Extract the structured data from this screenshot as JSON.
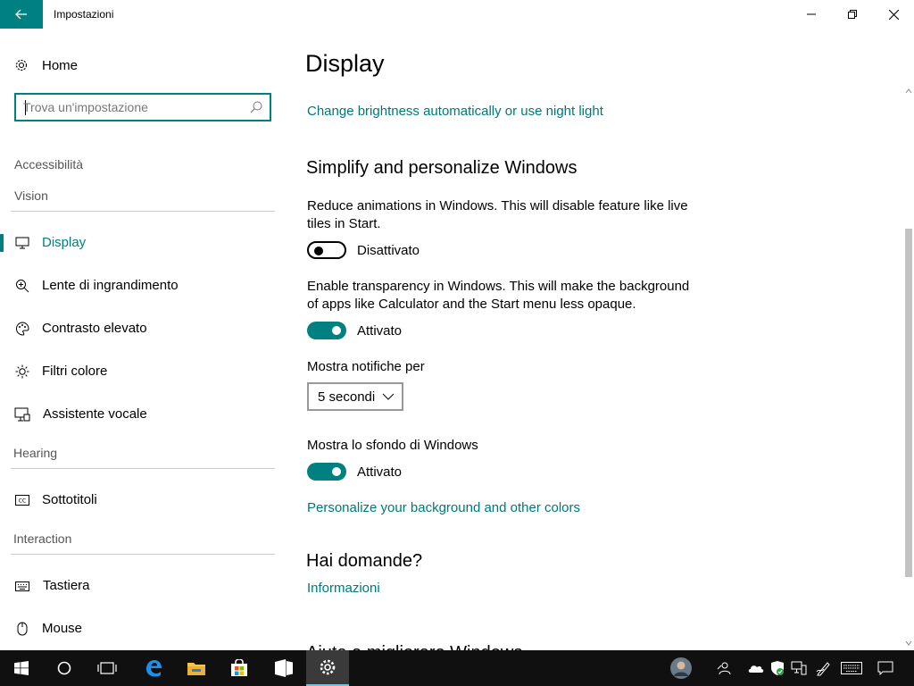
{
  "window": {
    "title": "Impostazioni",
    "back_icon": "arrow-left-icon",
    "accent": "#008080"
  },
  "sidebar": {
    "home_label": "Home",
    "search_placeholder": "Trova un'impostazione",
    "category": "Accessibilità",
    "sections": {
      "vision": "Vision",
      "hearing": "Hearing",
      "interaction": "Interaction"
    },
    "items": [
      {
        "label": "Display",
        "icon": "monitor-icon",
        "active": true
      },
      {
        "label": "Lente di ingrandimento",
        "icon": "magnifier-icon"
      },
      {
        "label": "Contrasto elevato",
        "icon": "palette-icon"
      },
      {
        "label": "Filtri colore",
        "icon": "sun-icon"
      },
      {
        "label": "Assistente vocale",
        "icon": "narrator-icon"
      },
      {
        "label": "Sottotitoli",
        "icon": "cc-icon"
      },
      {
        "label": "Tastiera",
        "icon": "keyboard-icon"
      },
      {
        "label": "Mouse",
        "icon": "mouse-icon"
      }
    ]
  },
  "main": {
    "title": "Display",
    "brightness_link": "Change brightness automatically or use night light",
    "simplify_heading": "Simplify and personalize Windows",
    "animations_desc": "Reduce animations in Windows.  This will disable feature like live tiles in Start.",
    "animations_state": "Disattivato",
    "transparency_desc": "Enable transparency in Windows.  This will make the background of apps like Calculator and the Start menu less opaque.",
    "transparency_state": "Attivato",
    "notifications_label": "Mostra notifiche per",
    "notifications_value": "5 secondi",
    "background_label": "Mostra lo sfondo di Windows",
    "background_state": "Attivato",
    "personalize_link": "Personalize your background and other colors",
    "questions_heading": "Hai domande?",
    "info_link": "Informazioni",
    "cut_heading": "Aiuta a migliorare Windows"
  },
  "taskbar": {
    "items": [
      "windows-start-icon",
      "cortana-icon",
      "task-view-icon",
      "edge-icon",
      "file-explorer-icon",
      "store-icon",
      "app-icon",
      "settings-icon"
    ],
    "tray": [
      "avatar",
      "people-icon",
      "onedrive-icon",
      "defender-icon",
      "network-icon",
      "pen-icon",
      "keyboard-icon",
      "notification-icon"
    ]
  }
}
